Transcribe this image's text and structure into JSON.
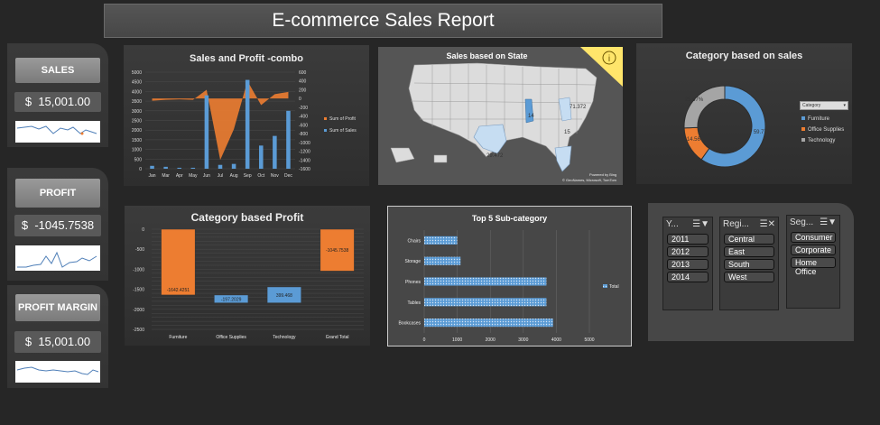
{
  "header": {
    "title": "E-commerce Sales Report"
  },
  "kpis": [
    {
      "label": "SALES",
      "currency": "$",
      "value": "15,001.00"
    },
    {
      "label": "PROFIT",
      "currency": "$",
      "value": "-1045.7538"
    },
    {
      "label": "PROFIT MARGIN",
      "currency": "$",
      "value": "15,001.00"
    }
  ],
  "map": {
    "title": "Sales based on State",
    "labels": [
      "71.372",
      "14",
      "15",
      "29.472"
    ],
    "credit1": "Powered by Bing",
    "credit2": "© GeoNames, Microsoft, TomTom",
    "info_icon": "info-icon"
  },
  "donut": {
    "title": "Category based on sales",
    "filter_label": "Category",
    "legend": [
      "Furniture",
      "Office Supplies",
      "Technology"
    ],
    "colors": [
      "#5b9bd5",
      "#ed7d31",
      "#a5a5a5"
    ]
  },
  "slicers": [
    {
      "header": "Y...",
      "items": [
        "2011",
        "2012",
        "2013",
        "2014"
      ]
    },
    {
      "header": "Regi...",
      "items": [
        "Central",
        "East",
        "South",
        "West"
      ]
    },
    {
      "header": "Seg...",
      "items": [
        "Consumer",
        "Corporate",
        "Home Office"
      ]
    }
  ],
  "chart_data": [
    {
      "type": "bar",
      "title": "Sales and Profit -combo",
      "categories": [
        "Jan",
        "Mar",
        "Apr",
        "May",
        "Jun",
        "Jul",
        "Aug",
        "Sep",
        "Oct",
        "Nov",
        "Dec"
      ],
      "series": [
        {
          "name": "Sum of Sales",
          "type": "bar",
          "values": [
            150,
            100,
            50,
            50,
            3800,
            200,
            250,
            4600,
            1200,
            1700,
            3000
          ]
        },
        {
          "name": "Sum of Profit",
          "type": "area",
          "values": [
            -50,
            -30,
            -20,
            -30,
            200,
            -1400,
            -700,
            400,
            -150,
            100,
            150
          ]
        }
      ],
      "y_left": {
        "ylim": [
          0,
          5000
        ],
        "ticks": [
          "5000",
          "4500",
          "4000",
          "3500",
          "3000",
          "2500",
          "2000",
          "1500",
          "1000",
          "500",
          "0"
        ]
      },
      "y_right": {
        "ylim": [
          -1600,
          600
        ],
        "ticks": [
          "600",
          "400",
          "200",
          "0",
          "-200",
          "-400",
          "-600",
          "-800",
          "-1000",
          "-1200",
          "-1400",
          "-1600"
        ]
      },
      "legend_position": "right",
      "colors": {
        "sales": "#5b9bd5",
        "profit": "#ed7d31"
      }
    },
    {
      "type": "pie",
      "title": "Category based on sales",
      "categories": [
        "Furniture",
        "Office Supplies",
        "Technology"
      ],
      "values": [
        59.77,
        14.56,
        25.67
      ],
      "labels": [
        "59.77%",
        "14.56%",
        "25.67%"
      ]
    },
    {
      "type": "bar",
      "title": "Category based Profit",
      "subtype": "waterfall",
      "categories": [
        "Furniture",
        "Office Supplies",
        "Technology",
        "Grand Total"
      ],
      "values": [
        -1642.4251,
        -197.2029,
        399.468,
        -1045.7538
      ],
      "labels": [
        "-1642.4251",
        "-197.2029",
        "399.468",
        "-1045.7538"
      ],
      "ylim": [
        -2500,
        0
      ],
      "yticks": [
        "0",
        "-500",
        "-1000",
        "-1500",
        "-2000",
        "-2500"
      ]
    },
    {
      "type": "bar",
      "title": "Top 5 Sub-category",
      "orientation": "horizontal",
      "categories": [
        "Chairs",
        "Storage",
        "Phones",
        "Tables",
        "Bookcases"
      ],
      "values": [
        1000,
        1100,
        3700,
        3700,
        3900
      ],
      "xlim": [
        0,
        5000
      ],
      "xticks": [
        "0",
        "1000",
        "2000",
        "3000",
        "4000",
        "5000"
      ],
      "legend": "Total"
    }
  ]
}
